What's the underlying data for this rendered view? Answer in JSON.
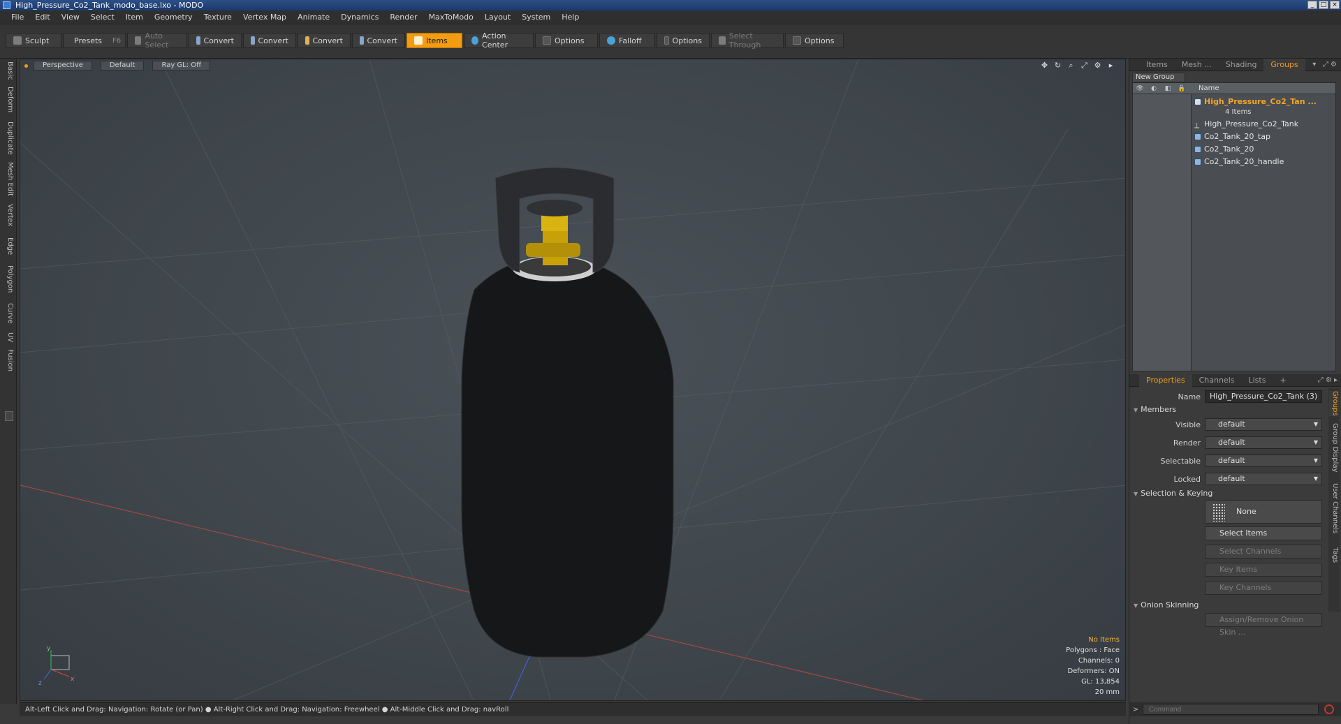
{
  "window": {
    "title": "High_Pressure_Co2_Tank_modo_base.lxo - MODO"
  },
  "menu": [
    "File",
    "Edit",
    "View",
    "Select",
    "Item",
    "Geometry",
    "Texture",
    "Vertex Map",
    "Animate",
    "Dynamics",
    "Render",
    "MaxToModo",
    "Layout",
    "System",
    "Help"
  ],
  "toolbar": {
    "sculpt": "Sculpt",
    "presets": "Presets",
    "presets_key": "F6",
    "auto_select": "Auto Select",
    "convert1": "Convert",
    "convert2": "Convert",
    "convert3": "Convert",
    "convert4": "Convert",
    "items": "Items",
    "action_center": "Action Center",
    "options1": "Options",
    "falloff": "Falloff",
    "options2": "Options",
    "select_through": "Select Through",
    "options3": "Options"
  },
  "left_tabs": [
    "Basic",
    "Deform",
    "Duplicate",
    "Mesh Edit",
    "Vertex",
    "Edge",
    "Polygon",
    "Curve",
    "UV",
    "Fusion"
  ],
  "viewport": {
    "view": "Perspective",
    "shading": "Default",
    "raygl": "Ray GL: Off",
    "stats": {
      "selection": "No Items",
      "polygons": "Polygons : Face",
      "channels": "Channels: 0",
      "deformers": "Deformers: ON",
      "gl": "GL: 13,854",
      "scale": "20 mm"
    },
    "axis_labels": {
      "x": "x",
      "y": "y",
      "z": "z"
    }
  },
  "status_bar": "Alt-Left Click and Drag: Navigation: Rotate (or Pan) ● Alt-Right Click and Drag: Navigation: Freewheel ● Alt-Middle Click and Drag: navRoll",
  "groups_panel": {
    "tabs": [
      "Items",
      "Mesh ...",
      "Shading",
      "Groups"
    ],
    "new_group": "New Group",
    "column_name": "Name",
    "group_name": "High_Pressure_Co2_Tan ...",
    "group_count": "4 Items",
    "items": [
      "High_Pressure_Co2_Tank",
      "Co2_Tank_20_tap",
      "Co2_Tank_20",
      "Co2_Tank_20_handle"
    ]
  },
  "properties": {
    "tabs": [
      "Properties",
      "Channels",
      "Lists",
      "+"
    ],
    "name_label": "Name",
    "name_value": "High_Pressure_Co2_Tank (3)",
    "members": "Members",
    "visible_label": "Visible",
    "visible_value": "default",
    "render_label": "Render",
    "render_value": "default",
    "selectable_label": "Selectable",
    "selectable_value": "default",
    "locked_label": "Locked",
    "locked_value": "default",
    "selection_keying": "Selection & Keying",
    "none_label": "None",
    "select_items": "Select Items",
    "select_channels": "Select Channels",
    "key_items": "Key Items",
    "key_channels": "Key Channels",
    "onion_skinning": "Onion Skinning",
    "assign_onion": "Assign/Remove Onion Skin ..."
  },
  "right_vtabs": [
    "Groups",
    "Group Display",
    "User Channels",
    "Tags"
  ],
  "command": {
    "placeholder": "Command"
  },
  "colors": {
    "accent": "#f39c12",
    "group_text": "#f5a623",
    "titlebar": "#1b3a6e"
  }
}
